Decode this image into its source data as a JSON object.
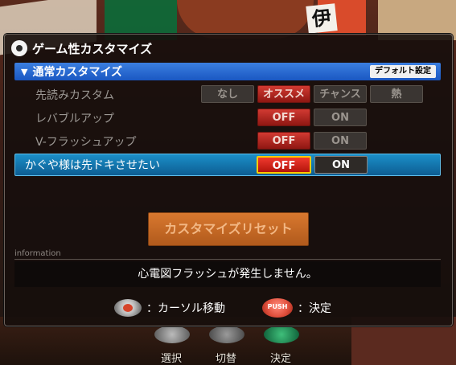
{
  "panel": {
    "title": "ゲーム性カスタマイズ",
    "section": {
      "label": "通常カスタマイズ",
      "default_button": "デフォルト設定"
    },
    "options": [
      {
        "label": "先読みカスタム",
        "choices": [
          "なし",
          "オススメ",
          "チャンス",
          "熱"
        ],
        "selected": "オススメ"
      },
      {
        "label": "レバブルアップ",
        "choices": [
          "OFF",
          "ON"
        ],
        "selected": "OFF"
      },
      {
        "label": "V-フラッシュアップ",
        "choices": [
          "OFF",
          "ON"
        ],
        "selected": "OFF"
      },
      {
        "label": "かぐや様は先ドキさせたい",
        "choices": [
          "OFF",
          "ON"
        ],
        "selected": "OFF",
        "focused": true
      }
    ],
    "reset_button": "カスタマイズリセット",
    "information": {
      "label": "information",
      "text": "心電図フラッシュが発生しません。"
    },
    "help": {
      "cursor": "：カーソル移動",
      "push_label": "PUSH",
      "confirm": "：決定"
    }
  },
  "hardware": {
    "labels": [
      "選択",
      "切替",
      "決定"
    ]
  },
  "background": {
    "kanji": "伊"
  },
  "colors": {
    "section_bar": "#1a57c2",
    "selected_chip": "#c0211a",
    "focus_row": "#1b8fc8",
    "reset_button": "#c86a26"
  }
}
